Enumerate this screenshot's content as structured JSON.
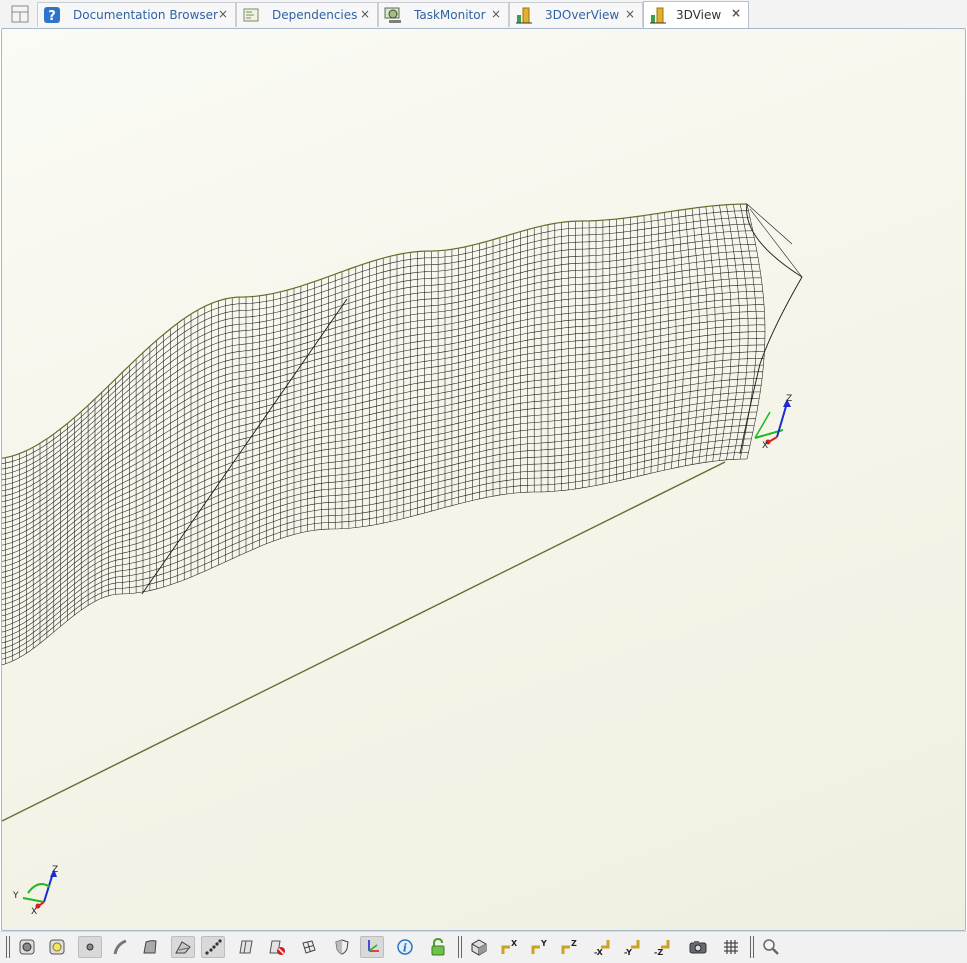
{
  "tabs": [
    {
      "label": "Documentation Browser",
      "icon": "help-icon",
      "active": false
    },
    {
      "label": "Dependencies",
      "icon": "dependencies-icon",
      "active": false
    },
    {
      "label": "TaskMonitor",
      "icon": "task-monitor-icon",
      "active": false
    },
    {
      "label": "3DOverView",
      "icon": "chart-3d-icon",
      "active": false
    },
    {
      "label": "3DView",
      "icon": "chart-3d-icon",
      "active": true
    }
  ],
  "tab_close_glyph": "×",
  "viewport": {
    "background_top": "#fbfbf6",
    "background_bottom": "#efefe1",
    "mesh_color": "#1a1a1a",
    "edge_color": "#6b6b2e"
  },
  "triad_local": {
    "z": "Z",
    "x": "X",
    "y": "Y"
  },
  "triad_global": {
    "z": "Z",
    "x": "X",
    "y": "Y"
  },
  "toolbar": {
    "buttons": [
      {
        "name": "select-shape-icon",
        "active": false
      },
      {
        "name": "select-node-icon",
        "active": false
      },
      {
        "name": "point-mode-icon",
        "active": true
      },
      {
        "name": "curve-mode-icon",
        "active": false
      },
      {
        "name": "surface-mode-icon",
        "active": false
      },
      {
        "name": "shaded-mode-icon",
        "active": true
      },
      {
        "name": "mesh-points-icon",
        "active": true
      },
      {
        "name": "section-view-icon",
        "active": false
      },
      {
        "name": "hide-section-icon",
        "active": false
      },
      {
        "name": "cube-planes-icon",
        "active": false
      },
      {
        "name": "shield-icon",
        "active": false
      },
      {
        "name": "axis-triad-icon",
        "active": true
      },
      {
        "name": "info-icon",
        "active": false
      },
      {
        "name": "lock-icon",
        "active": false
      },
      {
        "name": "iso-view-icon",
        "active": false
      },
      {
        "name": "view-plus-x-icon",
        "active": false
      },
      {
        "name": "view-plus-y-icon",
        "active": false
      },
      {
        "name": "view-plus-z-icon",
        "active": false
      },
      {
        "name": "view-minus-x-icon",
        "active": false
      },
      {
        "name": "view-minus-y-icon",
        "active": false
      },
      {
        "name": "view-minus-z-icon",
        "active": false
      },
      {
        "name": "camera-icon",
        "active": false
      },
      {
        "name": "grid-icon",
        "active": false
      },
      {
        "name": "zoom-icon",
        "active": false
      }
    ]
  }
}
